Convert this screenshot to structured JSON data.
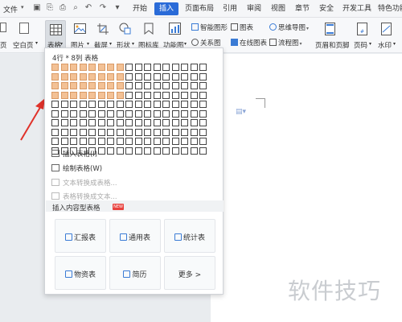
{
  "menubar": {
    "file_label": "文件",
    "tabs": [
      "开始",
      "插入",
      "页面布局",
      "引用",
      "审阅",
      "视图",
      "章节",
      "安全",
      "开发工具",
      "特色功能"
    ],
    "active_tab": "插入"
  },
  "ribbon": {
    "left_items": [
      "页",
      "空白页"
    ],
    "table_label": "表格",
    "picture_label": "图片",
    "screenshot_label": "截屏",
    "shape_label": "形状",
    "icon_library_label": "图标库",
    "function_chart_label": "功能图",
    "smart_graphic_label": "智能图形",
    "relation_graph_label": "关系图",
    "chart_label": "图表",
    "online_chart_label": "在线图表",
    "mind_map_label": "思维导图",
    "flowchart_label": "流程图",
    "header_footer_label": "页眉和页脚",
    "page_number_label": "页码",
    "watermark_label": "水印"
  },
  "dropdown": {
    "grid_title": "4行 * 8列 表格",
    "grid": {
      "rows": 10,
      "cols": 17,
      "selected_rows": 4,
      "selected_cols": 8
    },
    "menu_items": [
      {
        "label": "插入表格(I)",
        "disabled": false
      },
      {
        "label": "绘制表格(W)",
        "disabled": false
      },
      {
        "label": "文本转换成表格...",
        "disabled": true
      },
      {
        "label": "表格转换成文本...",
        "disabled": true
      }
    ],
    "section_title": "插入内容型表格",
    "section_badge": "NEW",
    "cards": [
      "汇报表",
      "通用表",
      "统计表",
      "物资表",
      "简历",
      "更多 >"
    ]
  },
  "watermark_text": "软件技巧",
  "colors": {
    "accent": "#2a6bd8",
    "grid_selected": "#f3c195",
    "arrow": "#e0322a"
  }
}
